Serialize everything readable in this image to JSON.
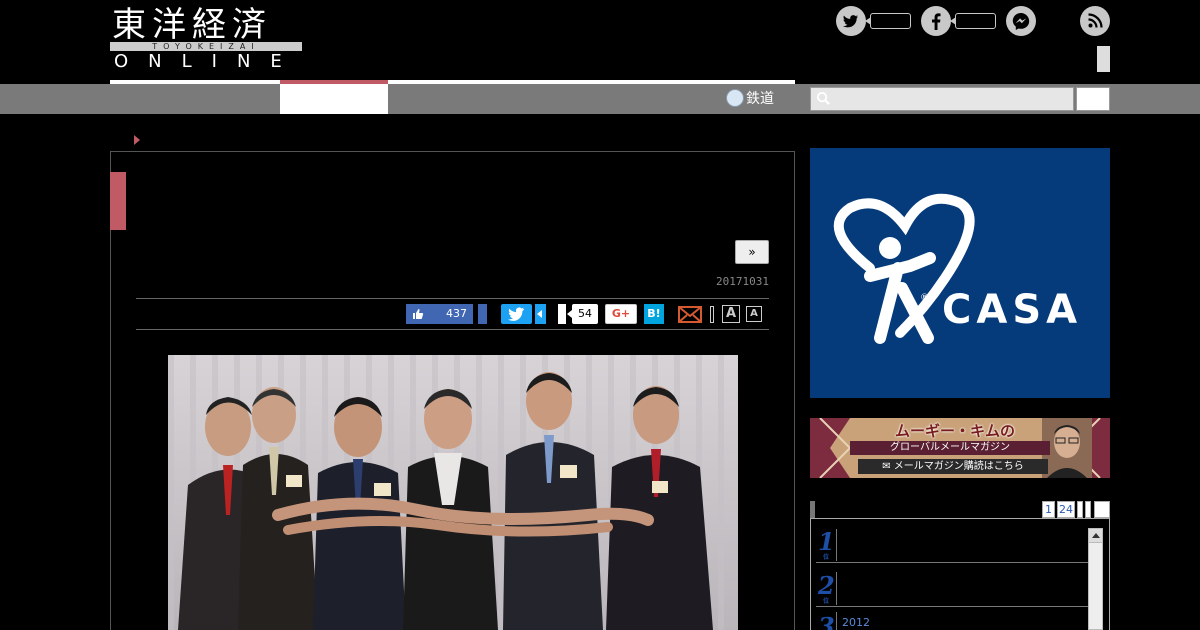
{
  "header": {
    "logo_kanji": "東洋経済",
    "logo_roman": "TOYOKEIZAI",
    "logo_online": "ONLINE",
    "social_icons": [
      "twitter-icon",
      "facebook-icon",
      "messenger-icon",
      "rss-icon"
    ]
  },
  "nav": {
    "tetsudo_label": "鉄道",
    "search_placeholder": ""
  },
  "article": {
    "date": "20171031",
    "more_label": "»",
    "share": {
      "facebook_count": "437",
      "hatena_count": "54",
      "gplus_label": "G+",
      "hatena_label": "B!",
      "font_large": "A",
      "font_small": "A"
    },
    "photo_alt": "photo"
  },
  "sidebar": {
    "ad_casa_text": "CASA",
    "ad_casa_reg": "®",
    "ad_mag": {
      "line1": "ムーギー・キムの",
      "line2": "グローバルメールマガジン",
      "line3": "✉ メールマガジン購読はこちら"
    },
    "ranking": {
      "tabs": [
        "1",
        "24"
      ],
      "items": [
        {
          "num": "1",
          "suffix": "位",
          "text": ""
        },
        {
          "num": "2",
          "suffix": "位",
          "text": ""
        },
        {
          "num": "3",
          "suffix": "位",
          "text": "2012"
        }
      ]
    }
  },
  "colors": {
    "accent": "#c05a64",
    "nav_bg": "#7a7a7a",
    "casa_bg": "#053b7a",
    "rank_num": "#1e4fa8"
  }
}
